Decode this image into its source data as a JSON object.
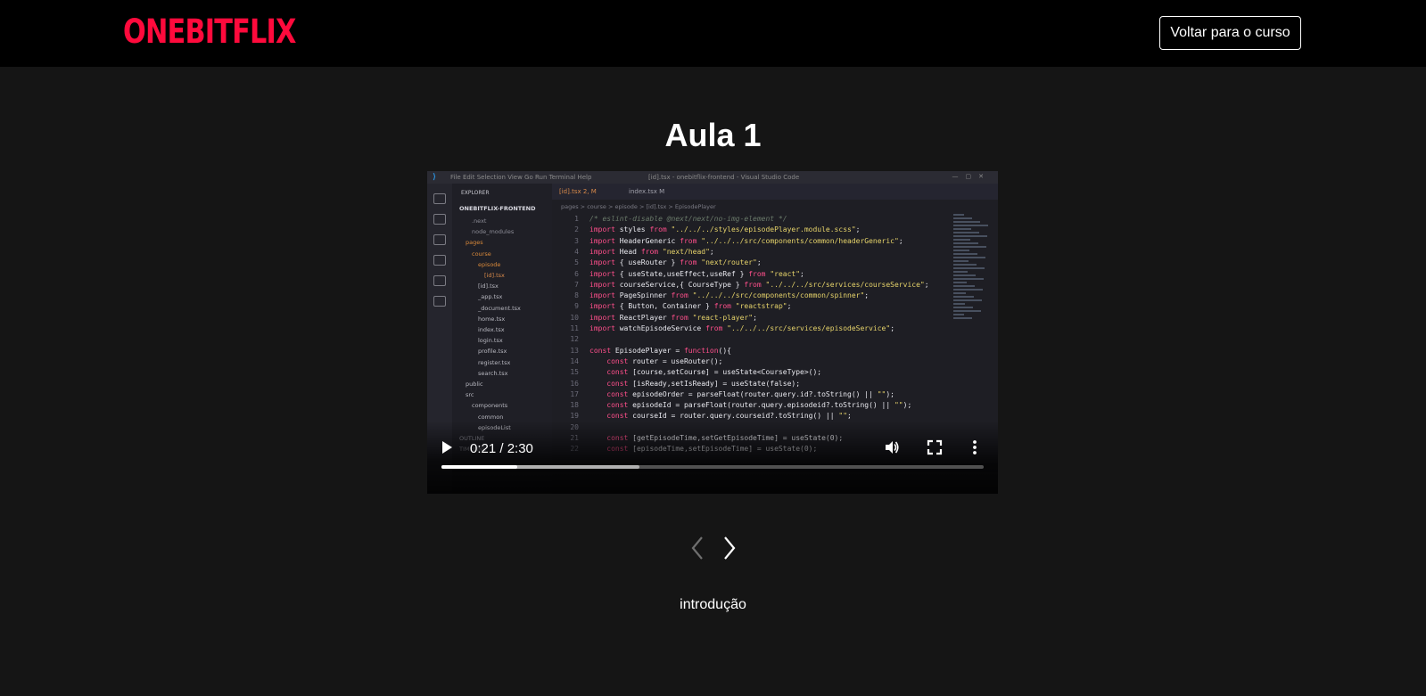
{
  "header": {
    "logo": "ONEBITFLIX",
    "back_button": "Voltar para o curso"
  },
  "lesson": {
    "title": "Aula 1",
    "episode_name": "introdução"
  },
  "player": {
    "time_text": "0:21 / 2:30",
    "current_seconds": 21,
    "duration_seconds": 150,
    "buffered_fraction": 0.365,
    "icons": {
      "play": "play-icon",
      "volume": "volume-icon",
      "fullscreen": "fullscreen-icon",
      "more": "more-vert-icon"
    }
  },
  "navigation": {
    "prev_icon": "chevron-left-icon",
    "next_icon": "chevron-right-icon"
  },
  "video_frame": {
    "window_title": "[id].tsx - onebitflix-frontend - Visual Studio Code",
    "menu": "File   Edit   Selection   View   Go   Run   Terminal   Help",
    "explorer_header": "EXPLORER",
    "project_name": "ONEBITFLIX-FRONTEND",
    "tree": [
      ".next",
      "node_modules",
      "pages",
      "course",
      "episode",
      "[id].tsx",
      "[id].tsx",
      "_app.tsx",
      "_document.tsx",
      "home.tsx",
      "index.tsx",
      "login.tsx",
      "profile.tsx",
      "register.tsx",
      "search.tsx",
      "public",
      "src",
      "components",
      "common",
      "episodeList",
      "OUTLINE",
      "TIMELINE"
    ],
    "tabs": [
      "[id].tsx 2, M",
      "index.tsx M"
    ],
    "breadcrumb": "pages > course > episode > [id].tsx > EpisodePlayer",
    "code_lines": [
      "/* eslint-disable @next/next/no-img-element */",
      "import styles from \"../../../styles/episodePlayer.module.scss\";",
      "import HeaderGeneric from \"../../../src/components/common/headerGeneric\";",
      "import Head from \"next/head\";",
      "import { useRouter } from \"next/router\";",
      "import { useState,useEffect,useRef } from \"react\";",
      "import courseService,{ CourseType } from \"../../../src/services/courseService\";",
      "import PageSpinner from \"../../../src/components/common/spinner\";",
      "import { Button, Container } from \"reactstrap\";",
      "import ReactPlayer from \"react-player\";",
      "import watchEpisodeService from \"../../../src/services/episodeService\";",
      "",
      "const EpisodePlayer = function(){",
      "    const router = useRouter();",
      "    const [course,setCourse] = useState<CourseType>();",
      "    const [isReady,setIsReady] = useState(false);",
      "    const episodeOrder = parseFloat(router.query.id?.toString() || \"\");",
      "    const episodeId = parseFloat(router.query.episodeid?.toString() || \"\");",
      "    const courseId = router.query.courseid?.toString() || \"\";",
      "",
      "    const [getEpisodeTime,setGetEpisodeTime] = useState(0);",
      "    const [episodeTime,setEpisodeTime] = useState(0);"
    ]
  }
}
